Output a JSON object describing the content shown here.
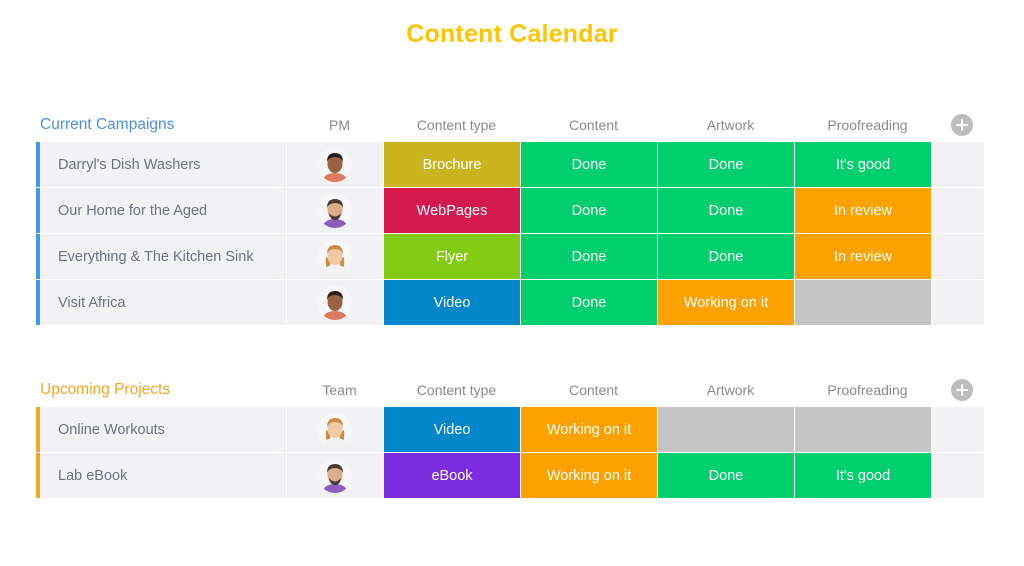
{
  "title": "Content Calendar",
  "colors": {
    "title": "#fdc400",
    "current_campaigns_accent": "#3d9bf5",
    "upcoming_projects_accent": "#f5a623",
    "done": "#00cf6e",
    "working_on_it": "#fba200",
    "in_review": "#fba200",
    "its_good": "#00cf6e",
    "empty": "#c4c4c4",
    "brochure": "#c9b41f",
    "webpages": "#d4194f",
    "flyer": "#82cb12",
    "video": "#0086c9",
    "ebook": "#7c2ce0"
  },
  "add_button_icon": "plus-icon",
  "boards": [
    {
      "id": "current",
      "title": "Current Campaigns",
      "title_color_class": "blue",
      "accent": "#3d9bf5",
      "columns": [
        "PM",
        "Content type",
        "Content",
        "Artwork",
        "Proofreading"
      ],
      "rows": [
        {
          "name": "Darryl's Dish Washers",
          "avatar": "avatar-man-dark-hair",
          "type": {
            "label": "Brochure",
            "color": "#c9b41f"
          },
          "content": {
            "label": "Done",
            "color": "#00cf6e"
          },
          "artwork": {
            "label": "Done",
            "color": "#00cf6e"
          },
          "proofreading": {
            "label": "It's good",
            "color": "#00cf6e"
          }
        },
        {
          "name": "Our Home for the Aged",
          "avatar": "avatar-man-beard",
          "type": {
            "label": "WebPages",
            "color": "#d4194f"
          },
          "content": {
            "label": "Done",
            "color": "#00cf6e"
          },
          "artwork": {
            "label": "Done",
            "color": "#00cf6e"
          },
          "proofreading": {
            "label": "In review",
            "color": "#fba200"
          }
        },
        {
          "name": "Everything & The Kitchen Sink",
          "avatar": "avatar-woman-blonde",
          "type": {
            "label": "Flyer",
            "color": "#82cb12"
          },
          "content": {
            "label": "Done",
            "color": "#00cf6e"
          },
          "artwork": {
            "label": "Done",
            "color": "#00cf6e"
          },
          "proofreading": {
            "label": "In review",
            "color": "#fba200"
          }
        },
        {
          "name": "Visit Africa",
          "avatar": "avatar-man-dark-hair",
          "type": {
            "label": "Video",
            "color": "#0086c9"
          },
          "content": {
            "label": "Done",
            "color": "#00cf6e"
          },
          "artwork": {
            "label": "Working on it",
            "color": "#fba200"
          },
          "proofreading": {
            "label": "",
            "color": "#c4c4c4"
          }
        }
      ]
    },
    {
      "id": "upcoming",
      "title": "Upcoming Projects",
      "title_color_class": "orange",
      "accent": "#f5a623",
      "columns": [
        "Team",
        "Content type",
        "Content",
        "Artwork",
        "Proofreading"
      ],
      "rows": [
        {
          "name": "Online Workouts",
          "avatar": "avatar-woman-blonde",
          "type": {
            "label": "Video",
            "color": "#0086c9"
          },
          "content": {
            "label": "Working on it",
            "color": "#fba200"
          },
          "artwork": {
            "label": "",
            "color": "#c4c4c4"
          },
          "proofreading": {
            "label": "",
            "color": "#c4c4c4"
          }
        },
        {
          "name": "Lab eBook",
          "avatar": "avatar-man-beard",
          "type": {
            "label": "eBook",
            "color": "#7c2ce0"
          },
          "content": {
            "label": "Working on it",
            "color": "#fba200"
          },
          "artwork": {
            "label": "Done",
            "color": "#00cf6e"
          },
          "proofreading": {
            "label": "It's good",
            "color": "#00cf6e"
          }
        }
      ]
    }
  ]
}
